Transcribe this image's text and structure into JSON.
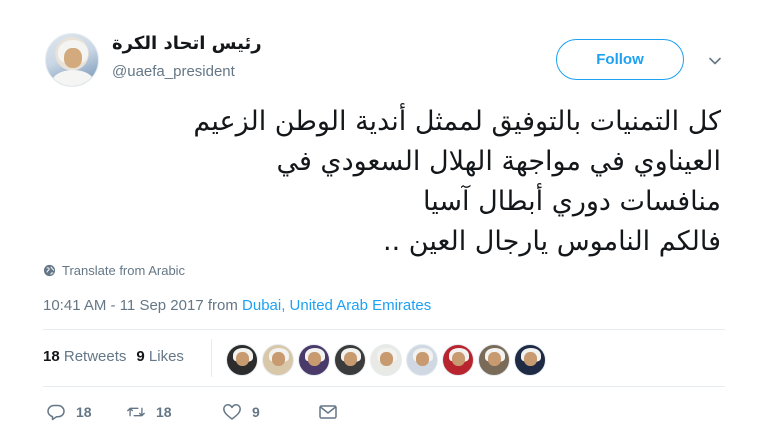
{
  "author": {
    "display_name": "رئيس اتحاد الكرة",
    "username": "@uaefa_president"
  },
  "follow_button": {
    "label": "Follow"
  },
  "tweet": {
    "lines": [
      "كل التمنيات بالتوفيق لممثل أندية الوطن الزعيم",
      "العيناوي في مواجهة الهلال السعودي في",
      "منافسات دوري أبطال آسيا",
      "فالكم الناموس يارجال العين .."
    ]
  },
  "translate": {
    "label": "Translate from Arabic"
  },
  "meta": {
    "time_prefix": "10:41 AM - 11 Sep 2017 from ",
    "location": "Dubai, United Arab Emirates"
  },
  "stats": {
    "retweets_count": "18",
    "retweets_label": "Retweets",
    "likes_count": "9",
    "likes_label": "Likes"
  },
  "likers": [
    {
      "name": "liker-avatar-1",
      "bg": "#2c2c2c"
    },
    {
      "name": "liker-avatar-2",
      "bg": "#d8c7a8"
    },
    {
      "name": "liker-avatar-3",
      "bg": "#4a3a6a"
    },
    {
      "name": "liker-avatar-4",
      "bg": "#3b3b3b"
    },
    {
      "name": "liker-avatar-5",
      "bg": "#e9e9e6"
    },
    {
      "name": "liker-avatar-6",
      "bg": "#cfd8e3"
    },
    {
      "name": "liker-avatar-7",
      "bg": "#b8252f"
    },
    {
      "name": "liker-avatar-8",
      "bg": "#7a6a58"
    },
    {
      "name": "liker-avatar-9",
      "bg": "#1f2a44"
    }
  ],
  "actions": {
    "reply_count": "18",
    "retweet_count": "18",
    "like_count": "9"
  },
  "colors": {
    "accent": "#1da1f2",
    "secondary_text": "#657786",
    "primary_text": "#14171a",
    "divider": "#e6ecf0"
  }
}
